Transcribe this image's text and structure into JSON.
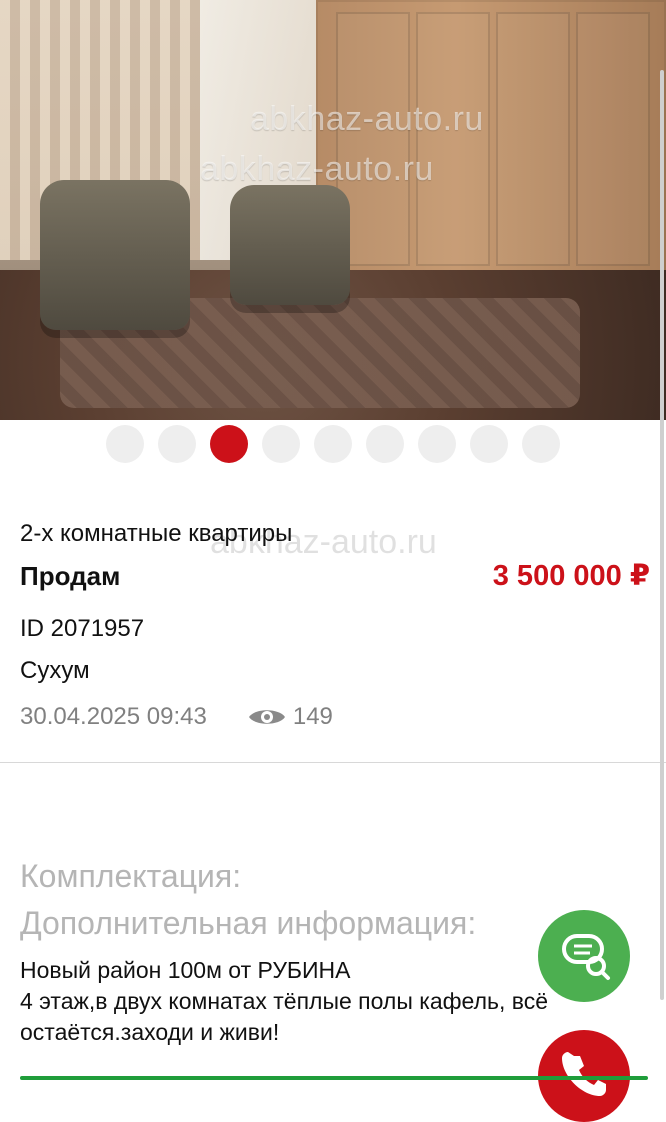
{
  "photo": {
    "watermark_text": "abkhaz-auto.ru"
  },
  "carousel": {
    "total": 9,
    "active_index": 2
  },
  "listing": {
    "type": "2-х комнатные квартиры",
    "deal": "Продам",
    "price": "3 500 000 ₽",
    "id": "ID 2071957",
    "city": "Сухум",
    "datetime": "30.04.2025 09:43",
    "views": "149"
  },
  "sections": {
    "equipment_label": "Комплектация:",
    "additional_label": "Дополнительная информация:"
  },
  "description": {
    "lines": [
      "Новый район 100м от РУБИНА",
      "4 этаж,в двух комнатах тёплые полы кафель, всё",
      "остаётся.заходи и живи!"
    ]
  },
  "colors": {
    "accent_red": "#cc1119",
    "accent_green": "#4caf50",
    "muted_gray": "#808080"
  },
  "icons": {
    "views_icon": "eye-icon",
    "chat_icon": "chat-icon",
    "call_icon": "phone-icon"
  }
}
